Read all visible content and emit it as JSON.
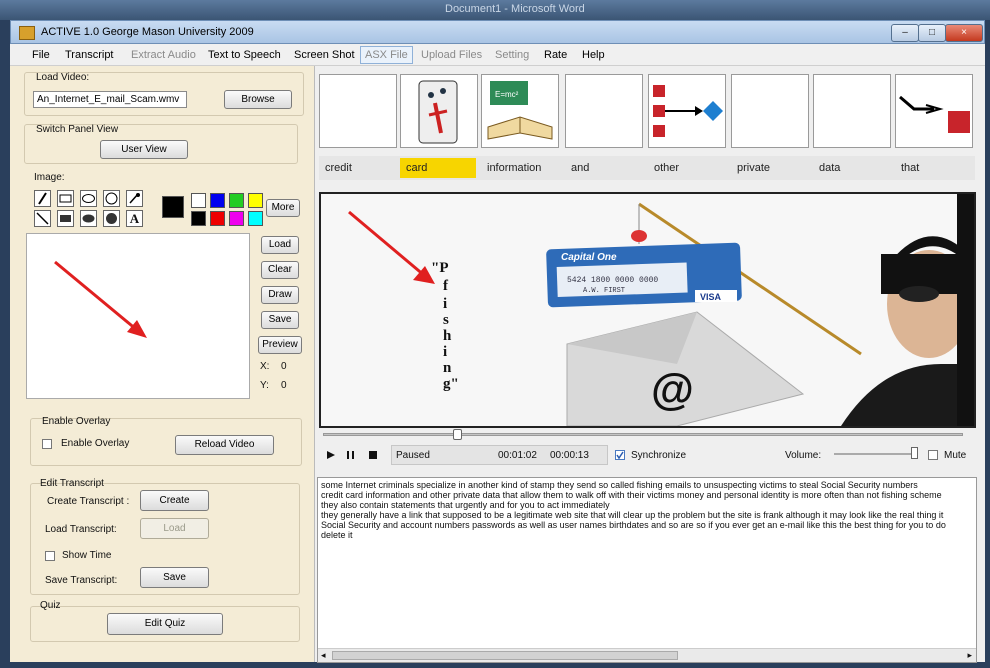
{
  "outer_window": {
    "title": "Document1 - Microsoft Word"
  },
  "window": {
    "title": "ACTIVE 1.0 George Mason University 2009",
    "controls": [
      "–",
      "□",
      "×"
    ]
  },
  "menu": [
    {
      "label": "File",
      "enabled": true
    },
    {
      "label": "Transcript",
      "enabled": true
    },
    {
      "label": "Extract Audio",
      "enabled": false
    },
    {
      "label": "Text to Speech",
      "enabled": true
    },
    {
      "label": "Screen Shot",
      "enabled": true
    },
    {
      "label": "ASX File",
      "enabled": false
    },
    {
      "label": "Upload Files",
      "enabled": false
    },
    {
      "label": "Setting",
      "enabled": false
    },
    {
      "label": "Rate",
      "enabled": true
    },
    {
      "label": "Help",
      "enabled": true
    }
  ],
  "load_video": {
    "group_label": "Load Video:",
    "file_value": "An_Internet_E_mail_Scam.wmv",
    "browse_label": "Browse"
  },
  "switch_panel": {
    "group_label": "Switch Panel View",
    "button_label": "User View"
  },
  "image_panel": {
    "label": "Image:",
    "more_label": "More",
    "colors": [
      "#000000",
      "#ffffff",
      "#0000ee",
      "#22cc22",
      "#ffff00",
      "#000000",
      "#ee0000",
      "#ee00ee",
      "#00ffff"
    ],
    "buttons": [
      "Load",
      "Clear",
      "Draw",
      "Save",
      "Preview"
    ],
    "x_label": "X:",
    "x_value": "0",
    "y_label": "Y:",
    "y_value": "0"
  },
  "overlay": {
    "group_label": "Enable Overlay",
    "checkbox_label": "Enable Overlay",
    "reload_label": "Reload Video"
  },
  "edit_transcript": {
    "group_label": "Edit Transcript",
    "create_label": "Create Transcript :",
    "create_button": "Create",
    "load_label": "Load Transcript:",
    "load_button": "Load",
    "show_time_label": "Show Time",
    "save_label": "Save Transcript:",
    "save_button": "Save"
  },
  "quiz": {
    "group_label": "Quiz",
    "button_label": "Edit Quiz"
  },
  "words": [
    "credit",
    "card",
    "information",
    "and",
    "other",
    "private",
    "data",
    "that"
  ],
  "highlight_color": "#f7d500",
  "video_overlay": {
    "text": "\"Pfishing\"",
    "card_bank": "Capital One",
    "card_number": "5424 1800 0000 0000",
    "card_name": "A.W. FIRST",
    "card_brand": "VISA",
    "email_symbol": "@"
  },
  "player": {
    "status": "Paused",
    "position": "00:01:02",
    "duration": "00:00:13",
    "sync_label": "Synchronize",
    "volume_label": "Volume:",
    "mute_label": "Mute",
    "seek_fraction": 0.21
  },
  "transcript": [
    "some Internet criminals specialize in another kind of stamp they send so called fishing emails to unsuspecting victims to steal Social Security numbers",
    "credit card information and other private data that allow them to walk off with their victims money and personal identity is more often than not fishing scheme",
    "they also contain statements that urgently and for you to act immediately",
    "they generally have a link that supposed to be a legitimate web site that will clear up the problem but the site is frank although it may look like the real thing it",
    "Social Security and account numbers passwords as well as user names birthdates and so are so if you ever get an e-mail like this the best thing for you to do",
    "delete it"
  ]
}
